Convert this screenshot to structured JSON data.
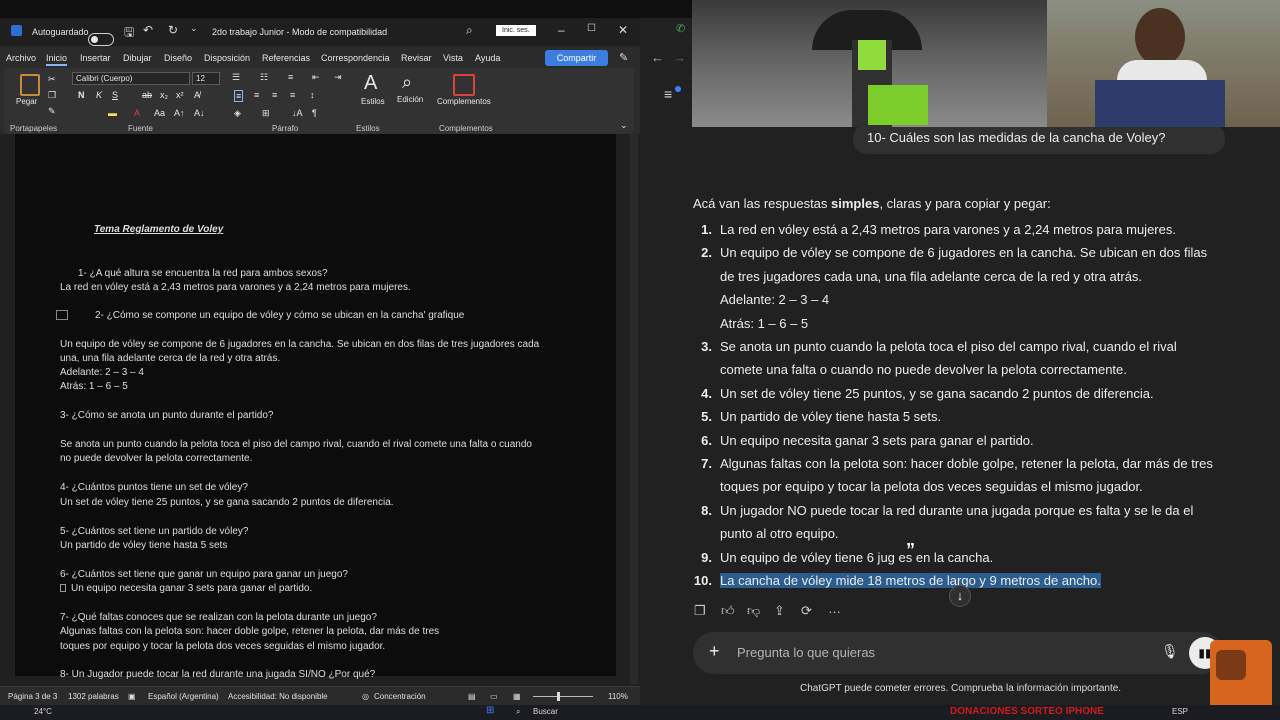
{
  "word": {
    "autosave_label": "Autoguardado",
    "doc_title": "2do trabajo Junior  -  Modo de compatibilidad",
    "signin": "Inic. ses.",
    "menu": [
      "Archivo",
      "Inicio",
      "Insertar",
      "Dibujar",
      "Diseño",
      "Disposición",
      "Referencias",
      "Correspondencia",
      "Revisar",
      "Vista",
      "Ayuda"
    ],
    "share": "Compartir",
    "ribbon": {
      "paste": "Pegar",
      "clipboard": "Portapapeles",
      "font_name": "Calibri (Cuerpo)",
      "font_size": "12",
      "font_group": "Fuente",
      "paragraph_group": "Párrafo",
      "styles": "Estilos",
      "styles_group": "Estilos",
      "editing": "Edición",
      "addins": "Complementos",
      "addins_group": "Complementos"
    },
    "document": {
      "title": "Tema Reglamento de Voley",
      "lines": [
        "1-   ¿A qué altura se encuentra la red para ambos sexos?",
        "La red en vóley está a 2,43 metros para varones y a 2,24 metros para mujeres.",
        "2-   ¿Cómo se compone un equipo de vóley y cómo se ubican en la cancha' grafique",
        "Un equipo de vóley se compone de 6 jugadores en la cancha. Se ubican en dos filas de tres jugadores cada",
        "una, una fila adelante cerca de la red y otra atrás.",
        "Adelante: 2 – 3 – 4",
        "Atrás: 1 – 6 – 5",
        "3- ¿Cómo se anota un punto durante el partido?",
        "Se anota un punto cuando la pelota toca el piso del campo rival, cuando el rival comete una falta o cuando",
        "no puede devolver la pelota correctamente.",
        "4- ¿Cuántos puntos tiene un set de vóley?",
        "Un set de vóley tiene 25 puntos, y se gana sacando 2 puntos de diferencia.",
        "5- ¿Cuántos set tiene un partido de vóley?",
        "Un partido de vóley tiene hasta 5 sets",
        "6- ¿Cuántos set tiene que ganar un equipo para ganar un juego?",
        "Un equipo necesita ganar 3 sets para ganar el partido.",
        "7- ¿Qué faltas conoces que se realizan con la pelota durante un juego?",
        "Algunas faltas con la pelota son: hacer doble golpe, retener la pelota, dar más de tres",
        "toques por equipo y tocar la pelota dos veces seguidas el mismo jugador.",
        "8- Un Jugador puede tocar la red durante una jugada SI/NO ¿Por qué?"
      ]
    },
    "status": {
      "page": "Página 3 de 3",
      "words": "1302 palabras",
      "language": "Español (Argentina)",
      "accessibility": "Accesibilidad: No disponible",
      "focus": "Concentración",
      "zoom": "110%"
    }
  },
  "chat": {
    "user_question": "10- Cuáles son las medidas de la cancha de Voley?",
    "intro_pre": "Acá van las respuestas ",
    "intro_bold": "simples",
    "intro_post": ", claras y para copiar y pegar:",
    "answers": [
      {
        "n": "1.",
        "lines": [
          "La red en vóley está a 2,43 metros para varones y a 2,24 metros para mujeres."
        ]
      },
      {
        "n": "2.",
        "lines": [
          "Un equipo de vóley se compone de 6 jugadores en la cancha. Se ubican en dos filas",
          "de tres jugadores cada una, una fila adelante cerca de la red y otra atrás.",
          "Adelante: 2 – 3 – 4",
          "Atrás: 1 – 6 – 5"
        ]
      },
      {
        "n": "3.",
        "lines": [
          "Se anota un punto cuando la pelota toca el piso del campo rival, cuando el rival",
          "comete una falta o cuando no puede devolver la pelota correctamente."
        ]
      },
      {
        "n": "4.",
        "lines": [
          "Un set de vóley tiene 25 puntos, y se gana sacando 2 puntos de diferencia."
        ]
      },
      {
        "n": "5.",
        "lines": [
          "Un partido de vóley tiene hasta 5 sets."
        ]
      },
      {
        "n": "6.",
        "lines": [
          "Un equipo necesita ganar 3 sets para ganar el partido."
        ]
      },
      {
        "n": "7.",
        "lines": [
          "Algunas faltas con la pelota son: hacer doble golpe, retener la pelota, dar más de tres",
          "toques por equipo y tocar la pelota dos veces seguidas el mismo jugador."
        ]
      },
      {
        "n": "8.",
        "lines": [
          "Un jugador NO puede tocar la red durante una jugada porque es falta y se le da el",
          "punto al otro equipo."
        ]
      },
      {
        "n": "9.",
        "lines": [
          "Un equipo de vóley tiene 6 jug      es en la cancha."
        ]
      },
      {
        "n": "10.",
        "lines": [
          "La cancha de vóley mide 18 metros de largo y 9 metros de ancho."
        ]
      }
    ],
    "composer_placeholder": "Pregunta lo que quieras",
    "disclaimer": "ChatGPT puede cometer errores. Comprueba la información importante."
  },
  "taskbar": {
    "temp": "24°C",
    "search": "Buscar",
    "lang": "ESP",
    "overlay_text": "DONACIONES SORTEO IPHONE"
  }
}
